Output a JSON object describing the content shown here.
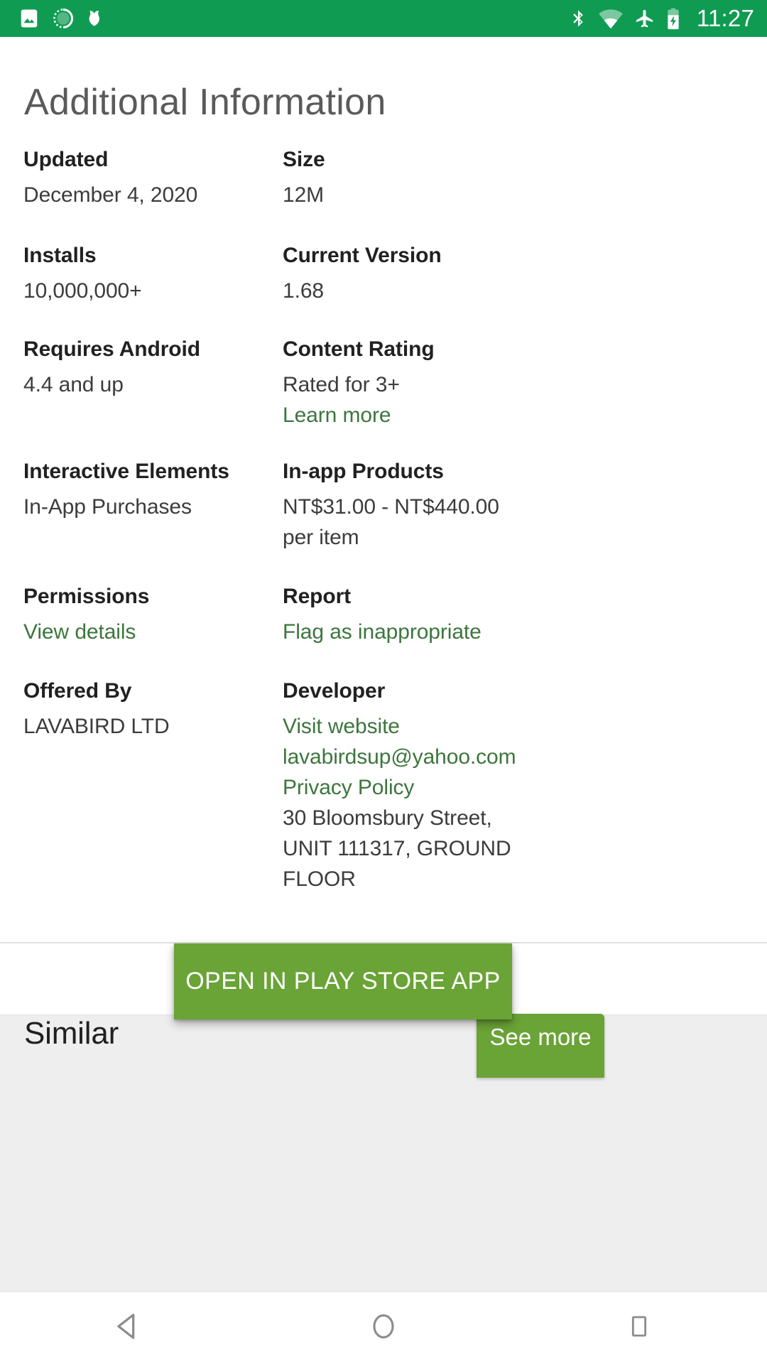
{
  "status_bar": {
    "background_color": "#109b53",
    "clock": "11:27",
    "left_icons": [
      {
        "name": "photo-icon",
        "label": "Screenshot / photo notification"
      },
      {
        "name": "loading-circle-icon",
        "label": "Sync in progress"
      },
      {
        "name": "malwarebytes-m-icon",
        "label": "Malwarebytes"
      }
    ],
    "right_icons": [
      {
        "name": "bluetooth-icon",
        "label": "Bluetooth on"
      },
      {
        "name": "wifi-icon",
        "label": "Wi-Fi connected"
      },
      {
        "name": "airplane-mode-icon",
        "label": "Airplane mode"
      },
      {
        "name": "battery-charging-icon",
        "label": "Battery charging"
      }
    ]
  },
  "page": {
    "title": "Additional Information",
    "accent_green": "#6aa336",
    "link_green": "#3c763d"
  },
  "info_rows": [
    {
      "left": {
        "label": "Updated",
        "values": [
          "December 4, 2020"
        ],
        "links": []
      },
      "right": {
        "label": "Size",
        "values": [
          "12M"
        ],
        "links": []
      }
    },
    {
      "left": {
        "label": "Installs",
        "values": [
          "10,000,000+"
        ],
        "links": []
      },
      "right": {
        "label": "Current Version",
        "values": [
          "1.68"
        ],
        "links": []
      }
    },
    {
      "left": {
        "label": "Requires Android",
        "values": [
          "4.4 and up"
        ],
        "links": []
      },
      "right": {
        "label": "Content Rating",
        "values": [
          "Rated for 3+"
        ],
        "links": [
          "Learn more"
        ]
      }
    },
    {
      "left": {
        "label": "Interactive Elements",
        "values": [
          "In-App Purchases"
        ],
        "links": []
      },
      "right": {
        "label": "In-app Products",
        "values": [
          "NT$31.00 - NT$440.00",
          "per item"
        ],
        "links": []
      }
    },
    {
      "left": {
        "label": "Permissions",
        "values": [],
        "links": [
          "View details"
        ]
      },
      "right": {
        "label": "Report",
        "values": [],
        "links": [
          "Flag as inappropriate"
        ]
      }
    },
    {
      "left": {
        "label": "Offered By",
        "values": [
          "LAVABIRD LTD"
        ],
        "links": []
      },
      "right": {
        "label": "Developer",
        "links_first": [
          "Visit website",
          "lavabirdsup@yahoo.com",
          "Privacy Policy"
        ],
        "values": [
          "30 Bloomsbury Street,",
          "UNIT 111317, GROUND",
          "FLOOR"
        ],
        "links": []
      }
    }
  ],
  "bottom": {
    "open_play_store_label": "OPEN IN PLAY STORE APP",
    "similar_title": "Similar",
    "see_more_label": "See more"
  },
  "nav_bar": {
    "back_label": "Back",
    "home_label": "Home",
    "recents_label": "Recent apps"
  }
}
